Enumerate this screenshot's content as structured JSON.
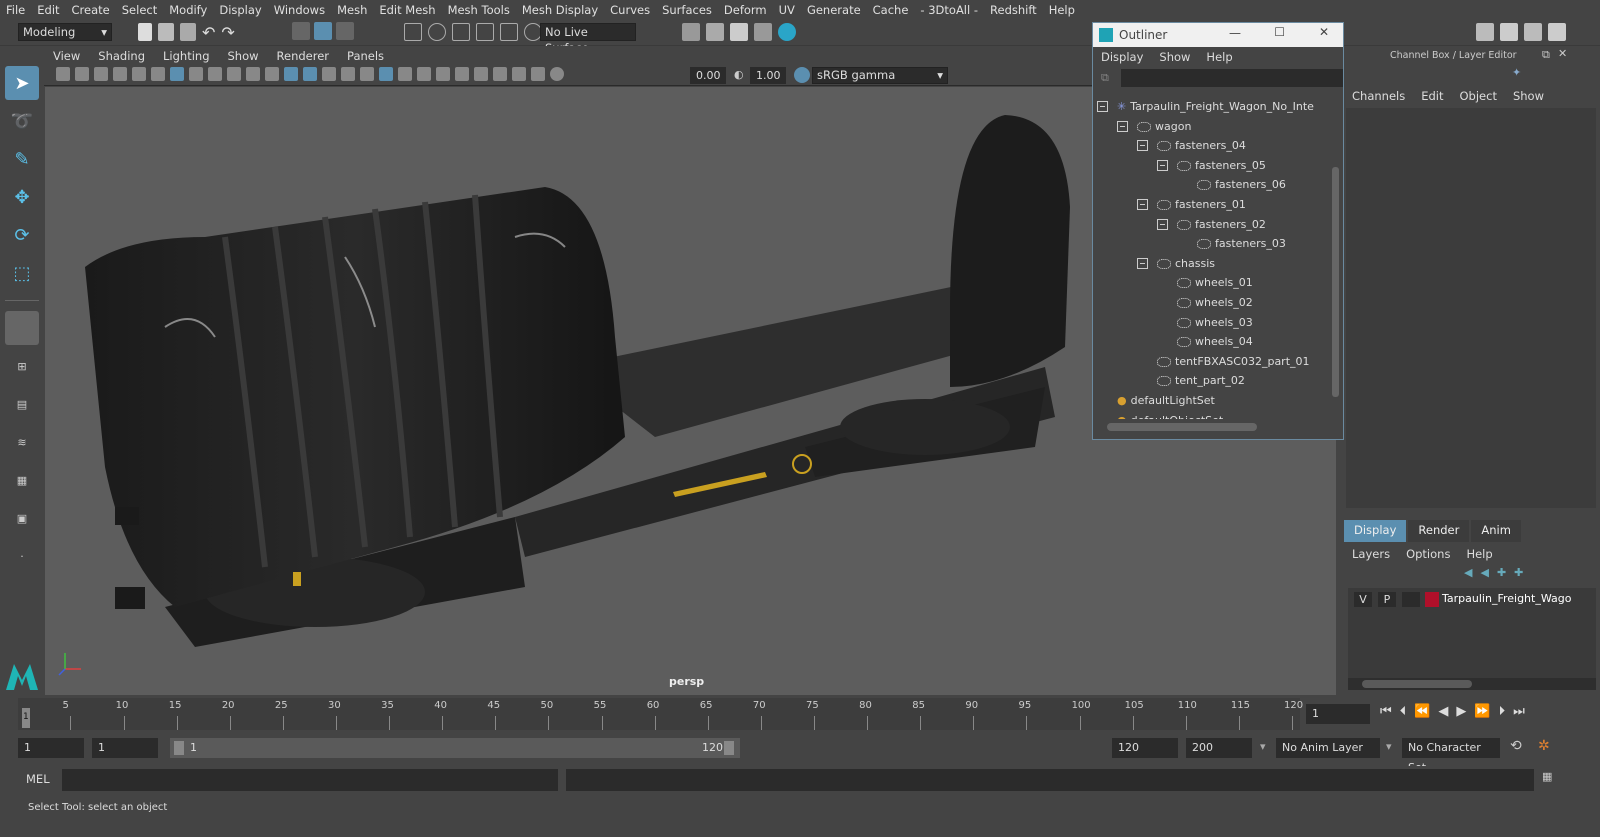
{
  "menubar": [
    "File",
    "Edit",
    "Create",
    "Select",
    "Modify",
    "Display",
    "Windows",
    "Mesh",
    "Edit Mesh",
    "Mesh Tools",
    "Mesh Display",
    "Curves",
    "Surfaces",
    "Deform",
    "UV",
    "Generate",
    "Cache",
    "- 3DtoAll -",
    "Redshift",
    "Help"
  ],
  "shelf": {
    "mode": "Modeling",
    "live_surface": "No Live Surface"
  },
  "viewport": {
    "menu": [
      "View",
      "Shading",
      "Lighting",
      "Show",
      "Renderer",
      "Panels"
    ],
    "exposure": "0.00",
    "gamma": "1.00",
    "color_space": "sRGB gamma",
    "camera_label": "persp",
    "axis": {
      "x": "x",
      "y": "y",
      "z": "z"
    }
  },
  "outliner": {
    "title": "Outliner",
    "menu": [
      "Display",
      "Show",
      "Help"
    ],
    "items": [
      {
        "label": "Tarpaulin_Freight_Wagon_No_Inte"
      },
      {
        "label": "wagon"
      },
      {
        "label": "fasteners_04"
      },
      {
        "label": "fasteners_05"
      },
      {
        "label": "fasteners_06"
      },
      {
        "label": "fasteners_01"
      },
      {
        "label": "fasteners_02"
      },
      {
        "label": "fasteners_03"
      },
      {
        "label": "chassis"
      },
      {
        "label": "wheels_01"
      },
      {
        "label": "wheels_02"
      },
      {
        "label": "wheels_03"
      },
      {
        "label": "wheels_04"
      },
      {
        "label": "tentFBXASC032_part_01"
      },
      {
        "label": "tent_part_02"
      },
      {
        "label": "defaultLightSet"
      },
      {
        "label": "defaultObjectSet"
      }
    ]
  },
  "channel_box": {
    "title": "Channel Box / Layer Editor",
    "menu": [
      "Channels",
      "Edit",
      "Object",
      "Show"
    ]
  },
  "layer_editor": {
    "tabs": [
      "Display",
      "Render",
      "Anim"
    ],
    "menu": [
      "Layers",
      "Options",
      "Help"
    ],
    "layer": {
      "v": "V",
      "p": "P",
      "name": "Tarpaulin_Freight_Wago",
      "color": "#b0102a"
    }
  },
  "timeline": {
    "ticks": [
      "5",
      "10",
      "15",
      "20",
      "25",
      "30",
      "35",
      "40",
      "45",
      "50",
      "55",
      "60",
      "65",
      "70",
      "75",
      "80",
      "85",
      "90",
      "95",
      "100",
      "105",
      "110",
      "115",
      "120"
    ],
    "start_marker": "1",
    "current_frame": "1"
  },
  "range": {
    "start": "1",
    "playback_start": "1",
    "slider_start": "1",
    "slider_end": "120",
    "playback_end": "120",
    "end": "200",
    "anim_layer": "No Anim Layer",
    "character_set": "No Character Set"
  },
  "cmdline": {
    "label": "MEL"
  },
  "helpline": {
    "text": "Select Tool: select an object"
  }
}
